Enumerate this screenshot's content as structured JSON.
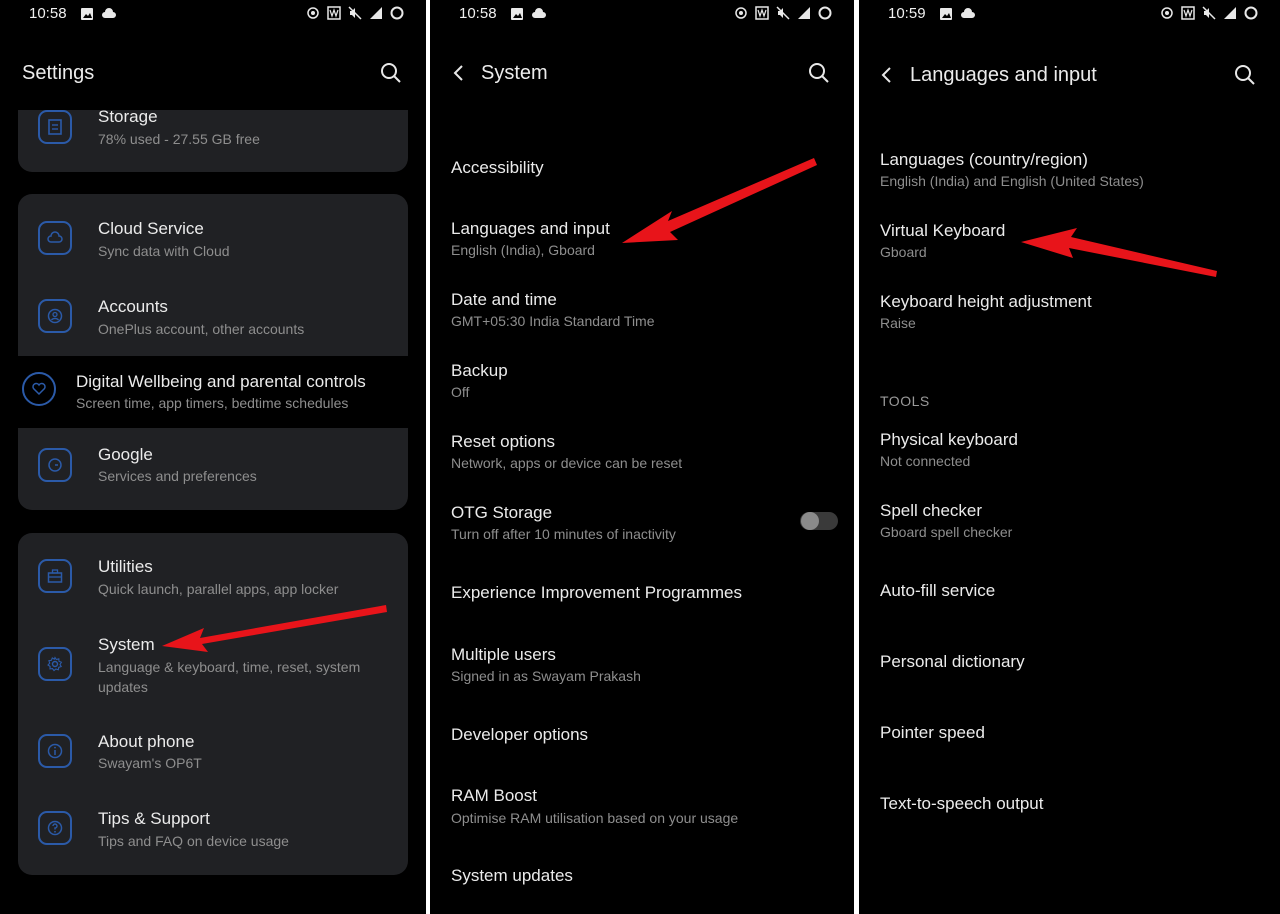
{
  "status_times": [
    "10:58",
    "10:58",
    "10:59"
  ],
  "settings_panel": {
    "title": "Settings",
    "storage": {
      "title": "Storage",
      "subtitle": "78% used - 27.55 GB free"
    },
    "cloud": {
      "title": "Cloud Service",
      "subtitle": "Sync data with Cloud"
    },
    "accounts": {
      "title": "Accounts",
      "subtitle": "OnePlus account, other accounts"
    },
    "wellbeing": {
      "title": "Digital Wellbeing and parental controls",
      "subtitle": "Screen time, app timers, bedtime schedules"
    },
    "google": {
      "title": "Google",
      "subtitle": "Services and preferences"
    },
    "utilities": {
      "title": "Utilities",
      "subtitle": "Quick launch, parallel apps, app locker"
    },
    "system": {
      "title": "System",
      "subtitle_1": "Language & keyboard, time, reset, system",
      "subtitle_2": "updates"
    },
    "about": {
      "title": "About phone",
      "subtitle": "Swayam's OP6T"
    },
    "tips": {
      "title": "Tips & Support",
      "subtitle": "Tips and FAQ on device usage"
    }
  },
  "system_panel": {
    "title": "System",
    "items": [
      {
        "title": "Accessibility",
        "subtitle": ""
      },
      {
        "title": "Languages and input",
        "subtitle": "English (India), Gboard"
      },
      {
        "title": "Date and time",
        "subtitle": "GMT+05:30 India Standard Time"
      },
      {
        "title": "Backup",
        "subtitle": "Off"
      },
      {
        "title": "Reset options",
        "subtitle": "Network, apps or device can be reset"
      },
      {
        "title": "OTG Storage",
        "subtitle": "Turn off after 10 minutes of inactivity"
      },
      {
        "title": "Experience Improvement Programmes",
        "subtitle": ""
      },
      {
        "title": "Multiple users",
        "subtitle": "Signed in as Swayam Prakash"
      },
      {
        "title": "Developer options",
        "subtitle": ""
      },
      {
        "title": "RAM Boost",
        "subtitle": "Optimise RAM utilisation based on your usage"
      },
      {
        "title": "System updates",
        "subtitle": ""
      }
    ],
    "otg_toggle_on": false
  },
  "languages_panel": {
    "title": "Languages and input",
    "items": [
      {
        "title": "Languages (country/region)",
        "subtitle": "English (India) and English (United States)"
      },
      {
        "title": "Virtual Keyboard",
        "subtitle": "Gboard"
      },
      {
        "title": "Keyboard height adjustment",
        "subtitle": "Raise"
      }
    ],
    "tools_label": "TOOLS",
    "tools": [
      {
        "title": "Physical keyboard",
        "subtitle": "Not connected"
      },
      {
        "title": "Spell checker",
        "subtitle": "Gboard spell checker"
      },
      {
        "title": "Auto-fill service",
        "subtitle": ""
      },
      {
        "title": "Personal dictionary",
        "subtitle": ""
      },
      {
        "title": "Pointer speed",
        "subtitle": ""
      },
      {
        "title": "Text-to-speech output",
        "subtitle": ""
      }
    ]
  },
  "colors": {
    "background": "#000000",
    "card": "#202124",
    "icon_accent": "#2b5aa8",
    "annotation_arrow": "#e8141a"
  }
}
